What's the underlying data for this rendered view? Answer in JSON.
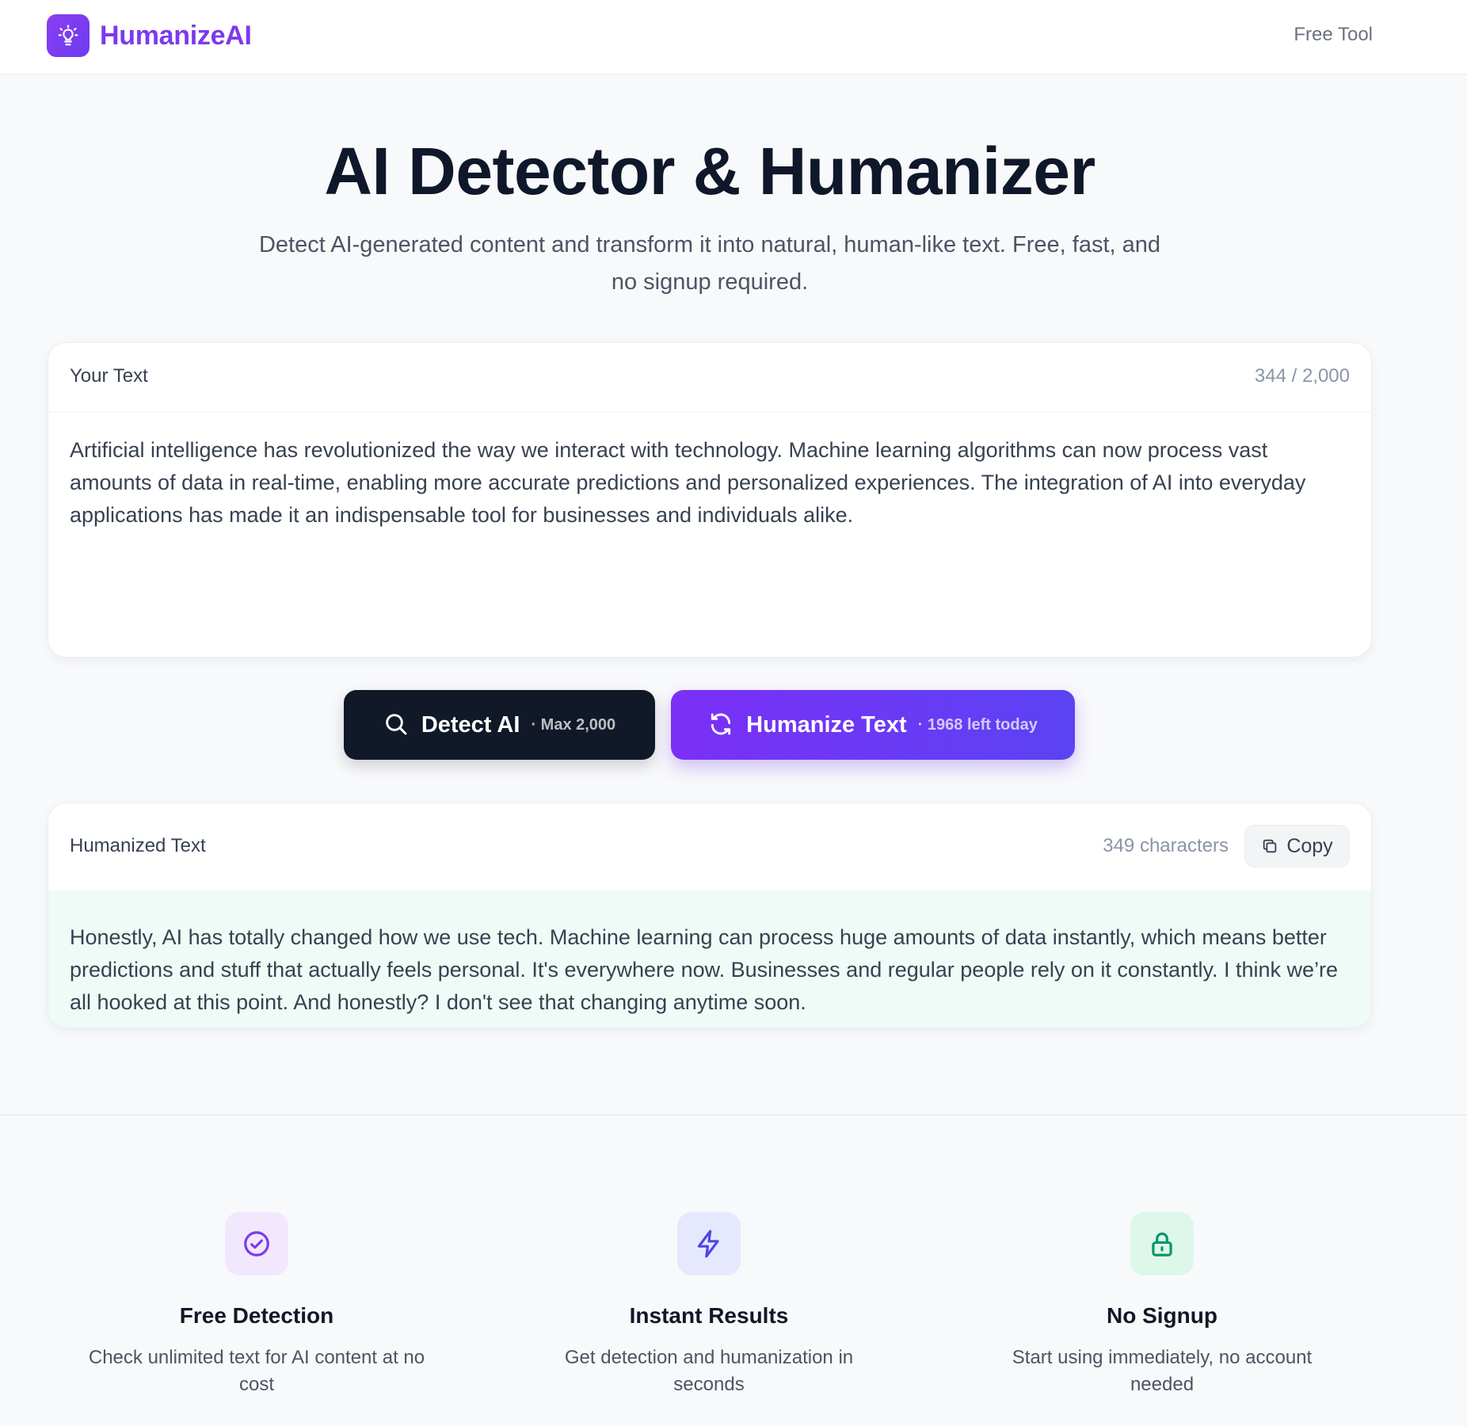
{
  "header": {
    "brand_name": "HumanizeAI",
    "nav_link": "Free Tool"
  },
  "hero": {
    "title": "AI Detector & Humanizer",
    "subtitle": "Detect AI-generated content and transform it into natural, human-like text. Free, fast, and no signup required."
  },
  "input": {
    "label": "Your Text",
    "count": "344 / 2,000",
    "text": "Artificial intelligence has revolutionized the way we interact with technology. Machine learning algorithms can now process vast amounts of data in real-time, enabling more accurate predictions and personalized experiences. The integration of AI into everyday applications has made it an indispensable tool for businesses and individuals alike."
  },
  "actions": {
    "detect_label": "Detect AI",
    "detect_sub": "· Max 2,000",
    "humanize_label": "Humanize Text",
    "humanize_sub": "· 1968 left today"
  },
  "output": {
    "label": "Humanized Text",
    "count": "349 characters",
    "copy_label": "Copy",
    "text": "Honestly, AI has totally changed how we use tech. Machine learning can process huge amounts of data instantly, which means better predictions and stuff that actually feels personal. It's everywhere now. Businesses and regular people rely on it constantly. I think we’re all hooked at this point. And honestly? I don't see that changing anytime soon."
  },
  "features": [
    {
      "icon": "check-circle-icon",
      "title": "Free Detection",
      "description": "Check unlimited text for AI content at no cost"
    },
    {
      "icon": "lightning-icon",
      "title": "Instant Results",
      "description": "Get detection and humanization in seconds"
    },
    {
      "icon": "lock-icon",
      "title": "No Signup",
      "description": "Start using immediately, no account needed"
    }
  ],
  "colors": {
    "brand": "#7c3aed",
    "detect_button": "#111827",
    "humanize_gradient_start": "#7b2ff7",
    "humanize_gradient_end": "#5b43f3",
    "output_background": "#effbf6"
  }
}
